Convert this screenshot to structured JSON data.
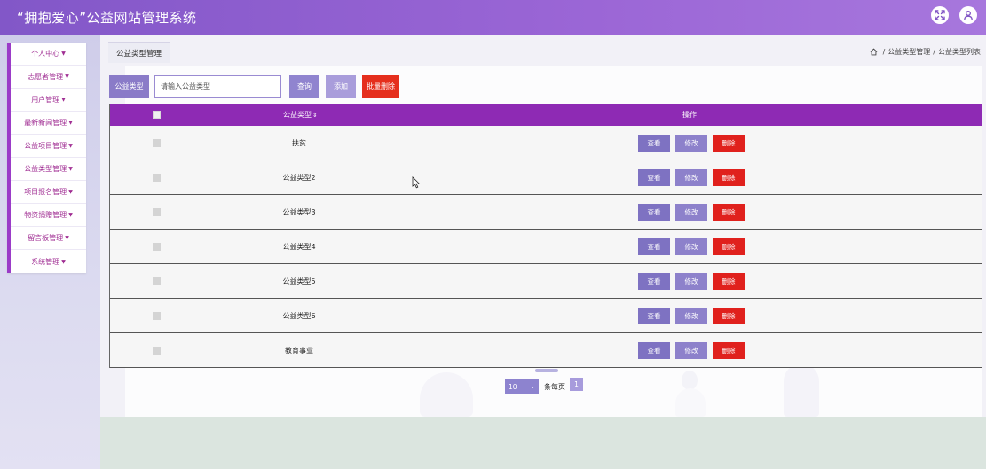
{
  "header": {
    "title": "“拥抱爱心”公益网站管理系统"
  },
  "icons": {
    "fullscreen": "fullscreen-icon",
    "user": "user-icon",
    "home": "home-icon",
    "sort": "sort-icon",
    "caret": "caret-down-icon"
  },
  "colors": {
    "header_start": "#8257c8",
    "header_end": "#a777dd",
    "table_header": "#8e2ab4",
    "delete": "#e0211d",
    "primary": "#8a7bc8",
    "sidebar_accent": "#9b3bc8",
    "sidebar_text": "#a02e93"
  },
  "sidebar": {
    "items": [
      {
        "label": "个人中心"
      },
      {
        "label": "志愿者管理"
      },
      {
        "label": "用户管理"
      },
      {
        "label": "最新新闻管理"
      },
      {
        "label": "公益项目管理"
      },
      {
        "label": "公益类型管理"
      },
      {
        "label": "项目报名管理"
      },
      {
        "label": "物资捐赠管理"
      },
      {
        "label": "留言板管理"
      },
      {
        "label": "系统管理"
      }
    ]
  },
  "main": {
    "tab_title": "公益类型管理",
    "breadcrumb": {
      "level1": "公益类型管理",
      "separator": "/",
      "level2": "公益类型列表"
    },
    "search": {
      "label": "公益类型",
      "placeholder": "请输入公益类型",
      "query_label": "查询",
      "add_label": "添加",
      "batch_delete_label": "批量删除"
    },
    "table": {
      "columns": {
        "type": "公益类型",
        "operations": "操作"
      },
      "rows": [
        {
          "type": "扶贫"
        },
        {
          "type": "公益类型2"
        },
        {
          "type": "公益类型3"
        },
        {
          "type": "公益类型4"
        },
        {
          "type": "公益类型5"
        },
        {
          "type": "公益类型6"
        },
        {
          "type": "教育事业"
        }
      ],
      "actions": {
        "view": "查看",
        "edit": "修改",
        "delete": "删除"
      }
    },
    "pagination": {
      "page_size": "10",
      "page_size_suffix": "条每页",
      "current_page": "1"
    }
  }
}
